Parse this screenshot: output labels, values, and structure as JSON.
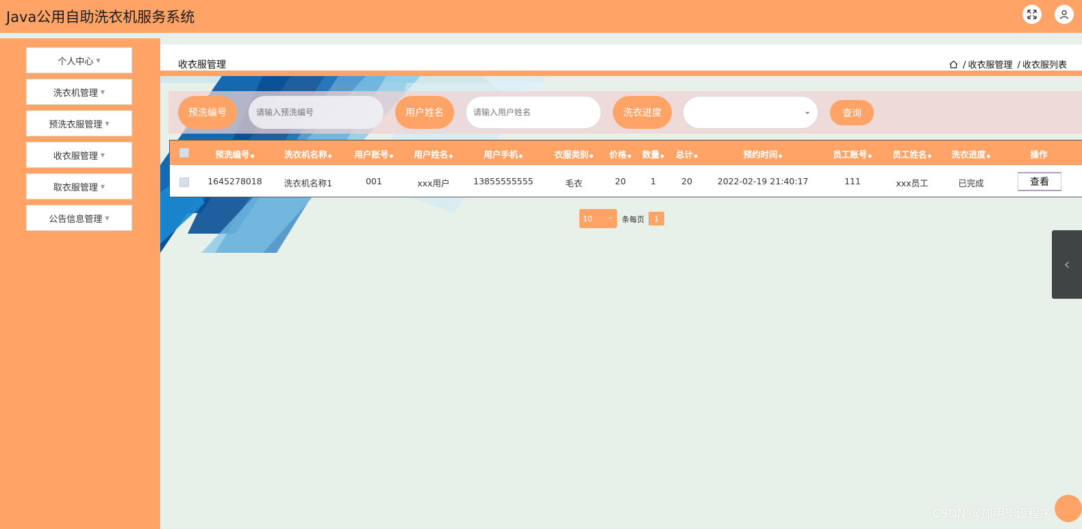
{
  "app": {
    "title": "Java公用自助洗衣机服务系统"
  },
  "header_icons": {
    "fullscreen": "fullscreen-icon",
    "user": "user-icon"
  },
  "sidebar": {
    "items": [
      {
        "label": "个人中心"
      },
      {
        "label": "洗衣机管理"
      },
      {
        "label": "预洗衣服管理"
      },
      {
        "label": "收衣服管理"
      },
      {
        "label": "取衣服管理"
      },
      {
        "label": "公告信息管理"
      }
    ]
  },
  "page": {
    "title": "收衣服管理",
    "breadcrumb": [
      "收衣服管理",
      "收衣服列表"
    ]
  },
  "search": {
    "field1_label": "预洗编号",
    "field1_placeholder": "请输入预洗编号",
    "field2_label": "用户姓名",
    "field2_placeholder": "请输入用户姓名",
    "field3_label": "洗衣进度",
    "field3_value": "",
    "query_label": "查询"
  },
  "table": {
    "columns": [
      "预洗编号",
      "洗衣机名称",
      "用户账号",
      "用户姓名",
      "用户手机",
      "衣服类别",
      "价格",
      "数量",
      "总计",
      "预约时间",
      "员工账号",
      "员工姓名",
      "洗衣进度",
      "操作"
    ],
    "rows": [
      {
        "cells": [
          "1645278018",
          "洗衣机名称1",
          "001",
          "xxx用户",
          "13855555555",
          "毛衣",
          "20",
          "1",
          "20",
          "2022-02-19 21:40:17",
          "111",
          "xxx员工",
          "已完成"
        ],
        "action": "查看"
      }
    ]
  },
  "pagination": {
    "page_size": "10",
    "per_page_label": "条每页",
    "current_page": "1"
  },
  "watermark": "CSDN @加明毕设程序",
  "colors": {
    "accent": "#ffa366",
    "background": "#e8f0ea"
  }
}
